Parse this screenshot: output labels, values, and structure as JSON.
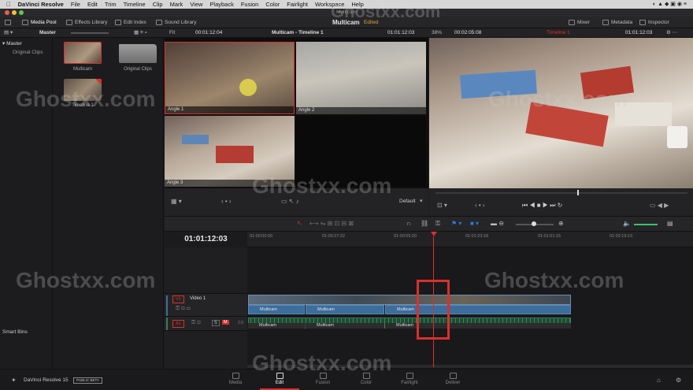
{
  "menubar": {
    "apple": "",
    "items": [
      "DaVinci Resolve",
      "File",
      "Edit",
      "Trim",
      "Timeline",
      "Clip",
      "Mark",
      "View",
      "Playback",
      "Fusion",
      "Color",
      "Fairlight",
      "Workspace",
      "Help"
    ]
  },
  "window_title": "Multicam",
  "toolbar": {
    "media_pool": "Media Pool",
    "effects_library": "Effects Library",
    "edit_index": "Edit Index",
    "sound_library": "Sound Library",
    "project_name": "Multicam",
    "edited": "Edited",
    "mixer": "Mixer",
    "metadata": "Metadata",
    "inspector": "Inspector"
  },
  "subbar": {
    "master": "Master",
    "fit": "Fit",
    "source_tc": "00:01:12:04",
    "source_name": "Multicam - Timeline 1",
    "source_tc2": "01:01:12:03",
    "zoom": "38%",
    "duration": "00:02:05:08",
    "timeline_name": "Timeline 1",
    "record_tc": "01:01:12:03"
  },
  "sidebar": {
    "master": "Master",
    "original_clips": "Original Clips",
    "smart_bins": "Smart Bins"
  },
  "media_pool": {
    "items": [
      {
        "label": "Multicam"
      },
      {
        "label": "Original Clips"
      },
      {
        "label": "Timeline 1"
      }
    ]
  },
  "multiview": {
    "angles": [
      "Angle 1",
      "Angle 2",
      "Angle 3"
    ],
    "view_mode": "Default"
  },
  "timeline": {
    "current_tc": "01:01:12:03",
    "ruler": [
      "01:00:00:00",
      "01:00:27:22",
      "01:00:55:20",
      "01:01:23:18",
      "01:01:51:15",
      "01:02:19:13"
    ],
    "video_track": {
      "id": "V1",
      "name": "Video 1"
    },
    "audio_track": {
      "id": "A1",
      "level": "2.0",
      "solo": "S",
      "mute": "M"
    },
    "clip_name": "Multicam"
  },
  "bottom": {
    "app_name": "DaVinci Resolve 15",
    "badge": "PUBLIC BETA",
    "pages": [
      "Media",
      "Edit",
      "Fusion",
      "Color",
      "Fairlight",
      "Deliver"
    ],
    "active_page": "Edit"
  },
  "watermark": "Ghostxx.com",
  "colors": {
    "accent_red": "#d9302c",
    "clip_blue": "#3c6d9b",
    "audio_green": "#1f4a33",
    "edited_orange": "#d9a337"
  }
}
